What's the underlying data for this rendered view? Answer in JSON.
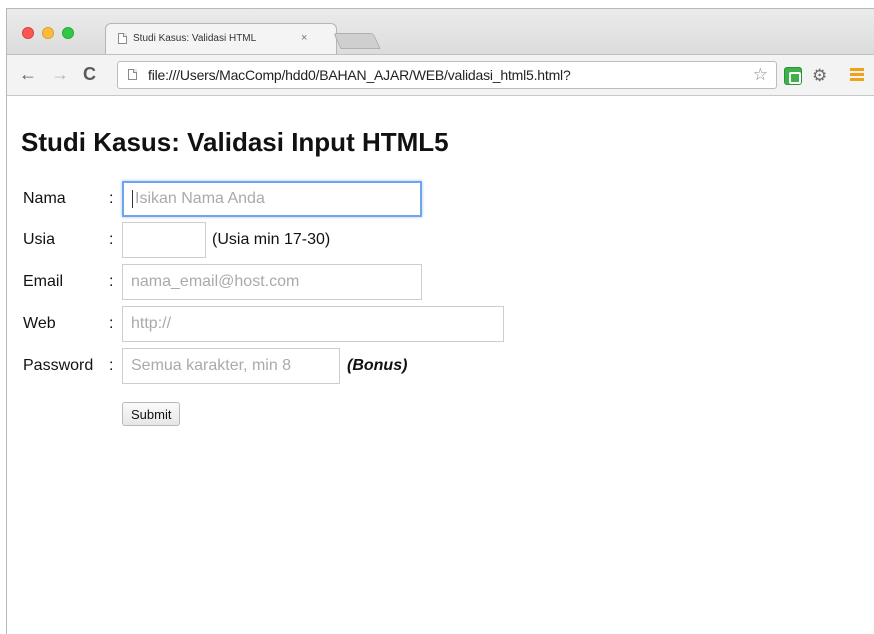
{
  "browser": {
    "tab_title": "Studi Kasus: Validasi HTML",
    "tab_close": "×",
    "url": "file:///Users/MacComp/hdd0/BAHAN_AJAR/WEB/validasi_html5.html?",
    "back_icon": "←",
    "forward_icon": "→",
    "reload_icon": "C",
    "star_icon": "☆",
    "extension_icon": "⚙"
  },
  "page": {
    "heading": "Studi Kasus: Validasi Input HTML5",
    "form": {
      "nama": {
        "label": "Nama",
        "colon": ":",
        "placeholder": "Isikan Nama Anda"
      },
      "usia": {
        "label": "Usia",
        "colon": ":",
        "value": "",
        "note": "(Usia min 17-30)"
      },
      "email": {
        "label": "Email",
        "colon": ":",
        "placeholder": "nama_email@host.com"
      },
      "web": {
        "label": "Web",
        "colon": ":",
        "placeholder": "http://"
      },
      "password": {
        "label": "Password",
        "colon": ":",
        "placeholder": "Semua karakter, min 8",
        "note": "(Bonus)"
      },
      "submit_label": "Submit"
    }
  }
}
